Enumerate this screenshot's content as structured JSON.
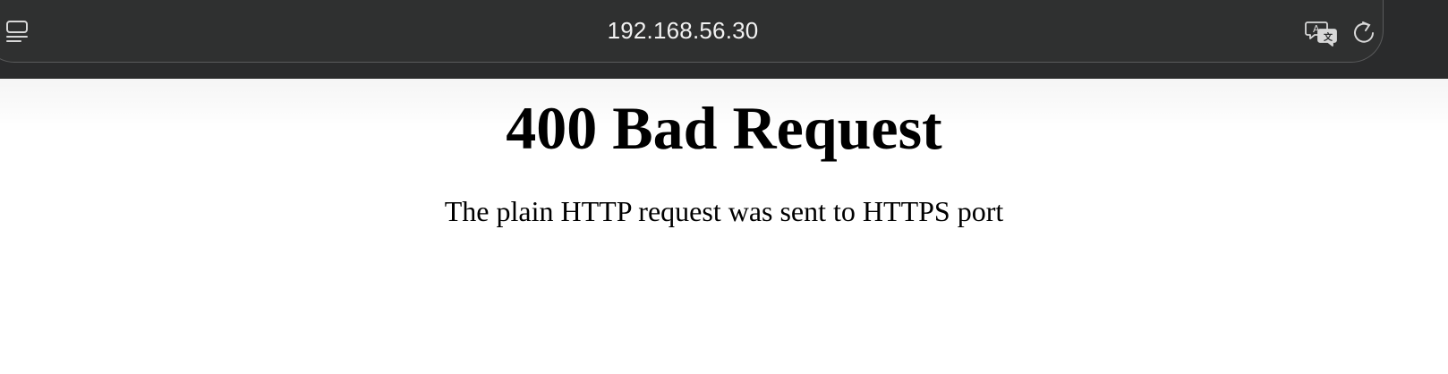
{
  "browser": {
    "url": "192.168.56.30",
    "icons": {
      "sidebar": "sidebar-icon",
      "translate": "translate-icon",
      "reload": "reload-icon"
    }
  },
  "page": {
    "heading": "400 Bad Request",
    "message": "The plain HTTP request was sent to HTTPS port"
  }
}
